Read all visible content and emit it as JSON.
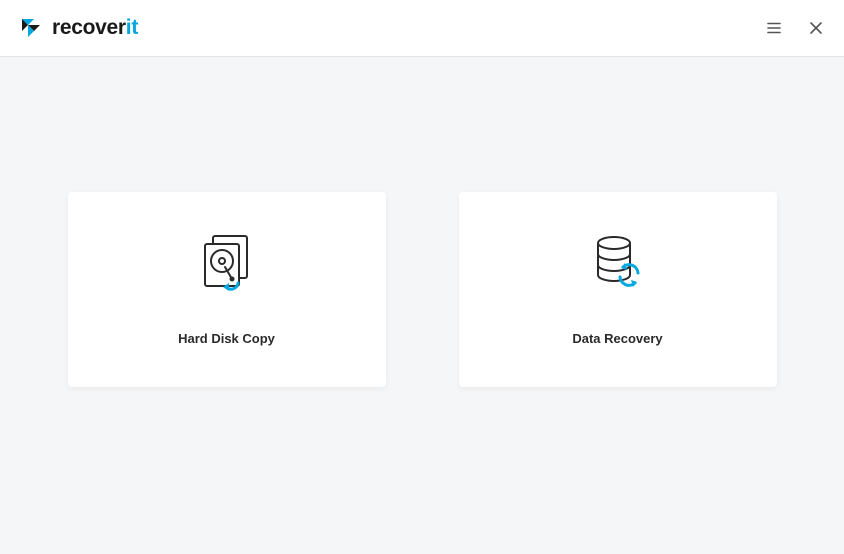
{
  "brand": {
    "name_part1": "recover",
    "name_part2": "it"
  },
  "cards": {
    "hard_disk_copy": {
      "title": "Hard Disk Copy"
    },
    "data_recovery": {
      "title": "Data Recovery"
    }
  }
}
